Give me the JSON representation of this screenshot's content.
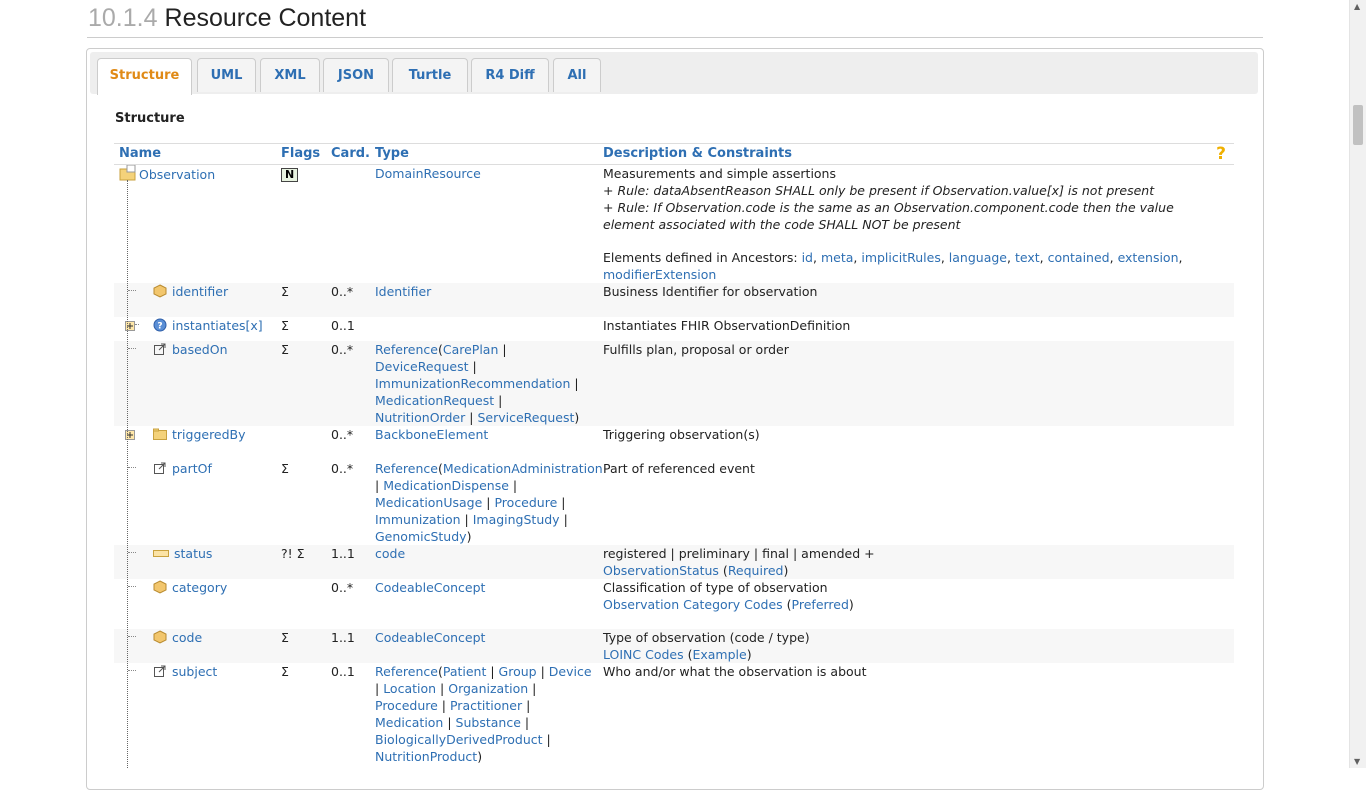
{
  "header": {
    "section_number": "10.1.4",
    "title": "Resource Content"
  },
  "tabs": [
    {
      "label": "Structure",
      "active": true
    },
    {
      "label": "UML"
    },
    {
      "label": "XML"
    },
    {
      "label": "JSON"
    },
    {
      "label": "Turtle"
    },
    {
      "label": "R4 Diff"
    },
    {
      "label": "All"
    }
  ],
  "structure_heading": "Structure",
  "columns": {
    "name": "Name",
    "flags": "Flags",
    "card": "Card.",
    "type": "Type",
    "desc": "Description & Constraints",
    "help": "?"
  },
  "rows": {
    "observation": {
      "name": "Observation",
      "flag": "N",
      "type": "DomainResource",
      "desc": "Measurements and simple assertions",
      "rule1": "+ Rule: dataAbsentReason SHALL only be present if Observation.value[x] is not present",
      "rule2": "+ Rule: If Observation.code is the same as an Observation.component.code then the value element associated with the code SHALL NOT be present",
      "ancestors_label": "Elements defined in Ancestors:",
      "ancestors": [
        "id",
        "meta",
        "implicitRules",
        "language",
        "text",
        "contained",
        "extension",
        "modifierExtension"
      ]
    },
    "identifier": {
      "name": "identifier",
      "flags": "Σ",
      "card": "0..*",
      "type": "Identifier",
      "desc": "Business Identifier for observation"
    },
    "instantiates": {
      "name": "instantiates[x]",
      "flags": "Σ",
      "card": "0..1",
      "desc": "Instantiates FHIR ObservationDefinition"
    },
    "basedOn": {
      "name": "basedOn",
      "flags": "Σ",
      "card": "0..*",
      "ref": "Reference",
      "targets": [
        "CarePlan",
        "DeviceRequest",
        "ImmunizationRecommendation",
        "MedicationRequest",
        "NutritionOrder",
        "ServiceRequest"
      ],
      "desc": "Fulfills plan, proposal or order"
    },
    "triggeredBy": {
      "name": "triggeredBy",
      "card": "0..*",
      "type": "BackboneElement",
      "desc": "Triggering observation(s)"
    },
    "partOf": {
      "name": "partOf",
      "flags": "Σ",
      "card": "0..*",
      "ref": "Reference",
      "targets": [
        "MedicationAdministration",
        "MedicationDispense",
        "MedicationUsage",
        "Procedure",
        "Immunization",
        "ImagingStudy",
        "GenomicStudy"
      ],
      "desc": "Part of referenced event"
    },
    "status": {
      "name": "status",
      "flags": "?! Σ",
      "card": "1..1",
      "type": "code",
      "desc": "registered | preliminary | final | amended +",
      "vs": "ObservationStatus",
      "strength": "Required"
    },
    "category": {
      "name": "category",
      "card": "0..*",
      "type": "CodeableConcept",
      "desc": "Classification of type of observation",
      "vs": "Observation Category Codes",
      "strength": "Preferred"
    },
    "code": {
      "name": "code",
      "flags": "Σ",
      "card": "1..1",
      "type": "CodeableConcept",
      "desc": "Type of observation (code / type)",
      "vs": "LOINC Codes",
      "strength": "Example"
    },
    "subject": {
      "name": "subject",
      "flags": "Σ",
      "card": "0..1",
      "ref": "Reference",
      "targets": [
        "Patient",
        "Group",
        "Device",
        "Location",
        "Organization",
        "Procedure",
        "Practitioner",
        "Medication",
        "Substance",
        "BiologicallyDerivedProduct",
        "NutritionProduct"
      ],
      "desc": "Who and/or what the observation is about"
    }
  },
  "colors": {
    "link": "#2e6fb3",
    "active_tab": "#e08a16"
  }
}
